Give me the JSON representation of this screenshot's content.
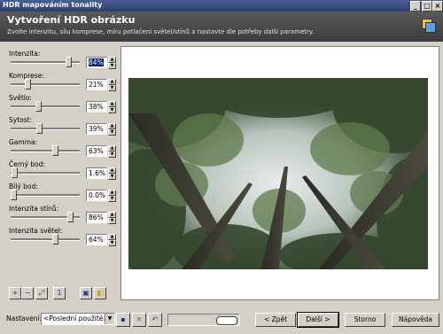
{
  "window": {
    "title": "HDR mapováním tonality"
  },
  "header": {
    "title": "Vytvoření HDR obrázku",
    "subtitle": "Zvolte intenzitu, sílu komprese, míru potlačení světel/stínů a nastavte dle potřeby další parametry."
  },
  "controls": [
    {
      "label": "Intenzita:",
      "value": "84%",
      "level": 0.84
    },
    {
      "label": "Komprese:",
      "value": "21%",
      "level": 0.21
    },
    {
      "label": "Světlo:",
      "value": "38%",
      "level": 0.38
    },
    {
      "label": "Sytost:",
      "value": "39%",
      "level": 0.39
    },
    {
      "label": "Gamma:",
      "value": "63%",
      "level": 0.63
    },
    {
      "label": "Černý bod:",
      "value": "1.6%",
      "level": 0.016
    },
    {
      "label": "Bílý bod:",
      "value": "0.0%",
      "level": 0.0
    },
    {
      "label": "Intenzita stínů:",
      "value": "86%",
      "level": 0.86
    },
    {
      "label": "Intenzita světel:",
      "value": "64%",
      "level": 0.64
    }
  ],
  "tools": [
    "zoom-in-icon",
    "zoom-out-icon",
    "fit-icon",
    "actual-size-icon",
    "image-icon",
    "compare-icon"
  ],
  "bottom": {
    "settings_label": "Nastavení:",
    "preset_value": "<Poslední použité>",
    "back": "< Zpět",
    "next": "Další >",
    "cancel": "Storno",
    "help": "Nápověda"
  },
  "colors": {
    "title_bar": "#2d3f6e",
    "header": "#4a4a4a",
    "face": "#d4d0c8"
  }
}
